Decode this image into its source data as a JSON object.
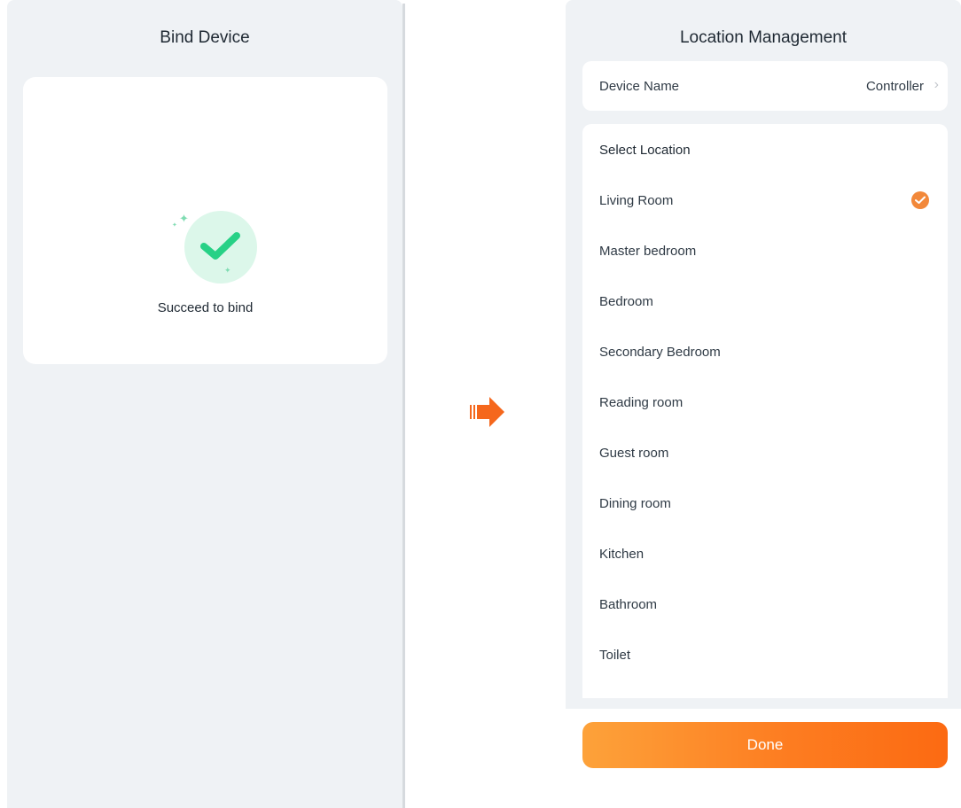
{
  "left_screen": {
    "title": "Bind Device",
    "success_icon": "check-icon",
    "success_text": "Succeed to bind",
    "accent_color": "#27d186"
  },
  "transition_arrow": {
    "icon": "right-arrow-icon",
    "color": "#f5671c"
  },
  "right_screen": {
    "title": "Location Management",
    "device_name": {
      "label": "Device Name",
      "value": "Controller",
      "chevron_icon": "chevron-right-icon"
    },
    "location_section": {
      "heading": "Select Location",
      "selected_index": 0,
      "items": [
        {
          "label": "Living Room"
        },
        {
          "label": "Master bedroom"
        },
        {
          "label": "Bedroom"
        },
        {
          "label": "Secondary Bedroom"
        },
        {
          "label": "Reading room"
        },
        {
          "label": "Guest room"
        },
        {
          "label": "Dining room"
        },
        {
          "label": "Kitchen"
        },
        {
          "label": "Bathroom"
        },
        {
          "label": "Toilet"
        }
      ]
    },
    "done_label": "Done",
    "accent_color": "#f2883a"
  }
}
